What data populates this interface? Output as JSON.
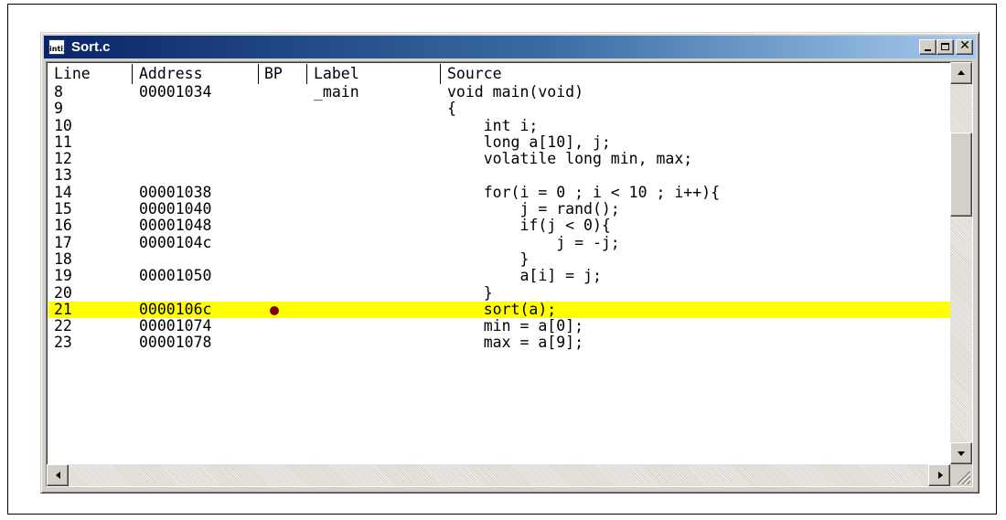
{
  "window": {
    "title": "Sort.c",
    "icon_text": "inti;",
    "icon": "document-icon"
  },
  "title_buttons": {
    "minimize_icon": "minimize-icon",
    "maximize_icon": "maximize-icon",
    "close_icon": "close-icon",
    "close_glyph": "✕"
  },
  "columns": [
    "Line",
    "Address",
    "BP",
    "Label",
    "Source"
  ],
  "rows": [
    {
      "line": "8",
      "address": "00001034",
      "label": "_main",
      "source": "void main(void)"
    },
    {
      "line": "9",
      "address": "",
      "label": "",
      "source": "{"
    },
    {
      "line": "10",
      "address": "",
      "label": "",
      "source": "    int i;"
    },
    {
      "line": "11",
      "address": "",
      "label": "",
      "source": "    long a[10], j;"
    },
    {
      "line": "12",
      "address": "",
      "label": "",
      "source": "    volatile long min, max;"
    },
    {
      "line": "13",
      "address": "",
      "label": "",
      "source": ""
    },
    {
      "line": "14",
      "address": "00001038",
      "label": "",
      "source": "    for(i = 0 ; i < 10 ; i++){"
    },
    {
      "line": "15",
      "address": "00001040",
      "label": "",
      "source": "        j = rand();"
    },
    {
      "line": "16",
      "address": "00001048",
      "label": "",
      "source": "        if(j < 0){"
    },
    {
      "line": "17",
      "address": "0000104c",
      "label": "",
      "source": "            j = -j;"
    },
    {
      "line": "18",
      "address": "",
      "label": "",
      "source": "        }"
    },
    {
      "line": "19",
      "address": "00001050",
      "label": "",
      "source": "        a[i] = j;"
    },
    {
      "line": "20",
      "address": "",
      "label": "",
      "source": "    }"
    },
    {
      "line": "21",
      "address": "0000106c",
      "label": "",
      "source": "    sort(a);"
    },
    {
      "line": "22",
      "address": "00001074",
      "label": "",
      "source": "    min = a[0];"
    },
    {
      "line": "23",
      "address": "00001078",
      "label": "",
      "source": "    max = a[9];"
    }
  ],
  "highlight": {
    "line": "21",
    "color": "#ffff00",
    "breakpoint_color": "#800000"
  },
  "scrollbars": {
    "vertical": {
      "up_icon": "arrow-up-icon",
      "down_icon": "arrow-down-icon"
    },
    "horizontal": {
      "left_icon": "arrow-left-icon",
      "right_icon": "arrow-right-icon"
    }
  },
  "colors": {
    "title_gradient_start": "#0a246a",
    "title_gradient_end": "#a6caf0",
    "chrome": "#d4d0c8"
  }
}
